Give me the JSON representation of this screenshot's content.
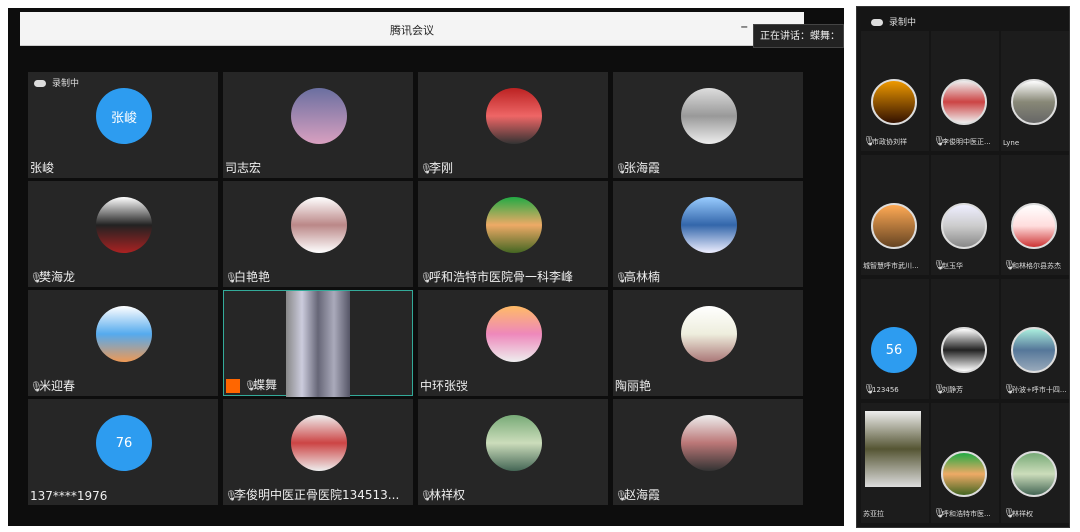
{
  "window": {
    "title": "腾讯会议",
    "minimize": "–",
    "speaking": "正在讲话：蝶舞："
  },
  "recording": "录制中",
  "tiles": [
    {
      "name": "张峻",
      "avatar_text": "张峻",
      "mic": false,
      "grad": "blue"
    },
    {
      "name": "司志宏",
      "mic": false,
      "grad": "linear-gradient(#6a6fa0,#d9a0c0)"
    },
    {
      "name": "李刚",
      "mic": true,
      "grad": "linear-gradient(#b22,#e66,#333)"
    },
    {
      "name": "张海霞",
      "mic": true,
      "grad": "linear-gradient(#ddd,#999,#eee)"
    },
    {
      "name": "樊海龙",
      "mic": true,
      "grad": "linear-gradient(#fff,#222,#a22)"
    },
    {
      "name": "白艳艳",
      "mic": true,
      "grad": "linear-gradient(#fff,#b88,#fff)"
    },
    {
      "name": "呼和浩特市医院骨一科李峰",
      "mic": true,
      "grad": "linear-gradient(#2a4,#ea6,#462)"
    },
    {
      "name": "高林楠",
      "mic": true,
      "grad": "linear-gradient(#9cf,#36a,#eef)"
    },
    {
      "name": "米迎春",
      "mic": true,
      "grad": "linear-gradient(#fff,#5ae,#e95)"
    },
    {
      "name": "蝶舞",
      "mic": true,
      "grad": "video"
    },
    {
      "name": "中环张弢",
      "mic": false,
      "grad": "linear-gradient(#fb6,#e8b,#eee)"
    },
    {
      "name": "陶丽艳",
      "mic": false,
      "grad": "linear-gradient(#fff,#eed,#a77)"
    },
    {
      "name": "137****1976",
      "avatar_text": "76",
      "mic": false,
      "grad": "blue"
    },
    {
      "name": "李俊明中医正骨医院134513...",
      "mic": true,
      "grad": "linear-gradient(#eee,#c44,#eee)"
    },
    {
      "name": "林祥权",
      "mic": true,
      "grad": "linear-gradient(#7a7,#cdb,#465)"
    },
    {
      "name": "赵海霞",
      "mic": true,
      "grad": "linear-gradient(#eee,#b77,#333)"
    }
  ],
  "phone": {
    "recording": "录制中",
    "tiles": [
      {
        "name": "市政协刘祥",
        "mic": true,
        "grad": "linear-gradient(#e90,#310)"
      },
      {
        "name": "李俊明中医正...",
        "mic": true,
        "grad": "linear-gradient(#eee,#c44,#eee)"
      },
      {
        "name": "Lyne",
        "mic": false,
        "grad": "linear-gradient(#fff,#887,#666)"
      },
      {
        "name": "城智慧呼市武川...",
        "mic": false,
        "grad": "linear-gradient(#fa5,#642)"
      },
      {
        "name": "赵玉华",
        "mic": true,
        "grad": "linear-gradient(#eef,#ccc,#888)"
      },
      {
        "name": "和林格尔县苏杰",
        "mic": true,
        "grad": "linear-gradient(#fff,#fdd,#c33)"
      },
      {
        "name": "123456",
        "avatar_text": "56",
        "mic": true,
        "grad": "blue"
      },
      {
        "name": "刘静芳",
        "mic": true,
        "grad": "linear-gradient(#fff,#222,#fff)"
      },
      {
        "name": "孙波+呼市十四...",
        "mic": true,
        "grad": "linear-gradient(#aed,#579,#9ab)"
      },
      {
        "name": "苏亚拉",
        "mic": false,
        "grad": "video"
      },
      {
        "name": "呼和浩特市医...",
        "mic": true,
        "grad": "linear-gradient(#2a4,#ea6,#462)"
      },
      {
        "name": "林祥权",
        "mic": true,
        "grad": "linear-gradient(#7a7,#cdb,#465)"
      }
    ]
  }
}
